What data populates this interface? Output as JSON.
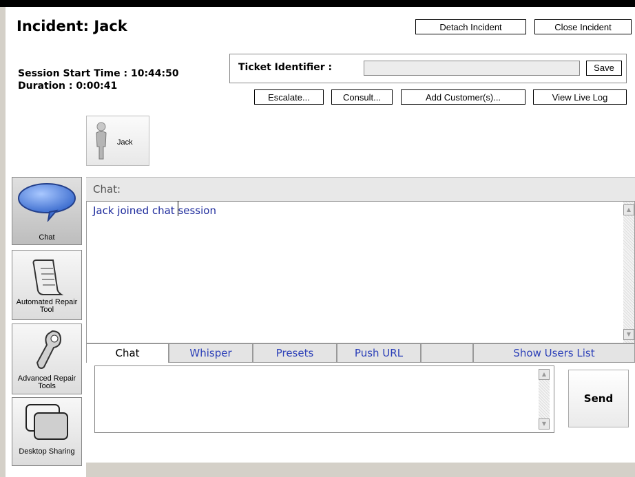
{
  "incident": {
    "title": "Incident: Jack"
  },
  "toolbar": {
    "detach_label": "Detach Incident",
    "close_label": "Close Incident"
  },
  "session": {
    "start_time": "Session Start Time : 10:44:50",
    "duration": "Duration : 0:00:41"
  },
  "ticket": {
    "label": "Ticket Identifier :",
    "value": "",
    "save_label": "Save"
  },
  "actions": {
    "escalate": "Escalate...",
    "consult": "Consult...",
    "add_customers": "Add Customer(s)...",
    "view_log": "View Live Log"
  },
  "participant": {
    "name": "Jack",
    "icon": "person-icon"
  },
  "sidebar": {
    "items": [
      {
        "label": "Chat",
        "icon": "chat-bubble-icon",
        "active": true
      },
      {
        "label": "Automated Repair Tool",
        "icon": "scroll-icon",
        "active": false
      },
      {
        "label": "Advanced Repair Tools",
        "icon": "wrench-icon",
        "active": false
      },
      {
        "label": "Desktop Sharing",
        "icon": "desktop-sharing-icon",
        "active": false
      }
    ]
  },
  "chat": {
    "header": "Chat:",
    "messages": [
      "Jack joined chat session"
    ],
    "tabs": [
      "Chat",
      "Whisper",
      "Presets",
      "Push URL",
      "",
      "Show Users List"
    ],
    "input_value": "",
    "send_label": "Send"
  },
  "colors": {
    "link_blue": "#2b3fb8",
    "message_blue": "#1d2a9c",
    "chat_bubble": "#5b8ee6"
  }
}
